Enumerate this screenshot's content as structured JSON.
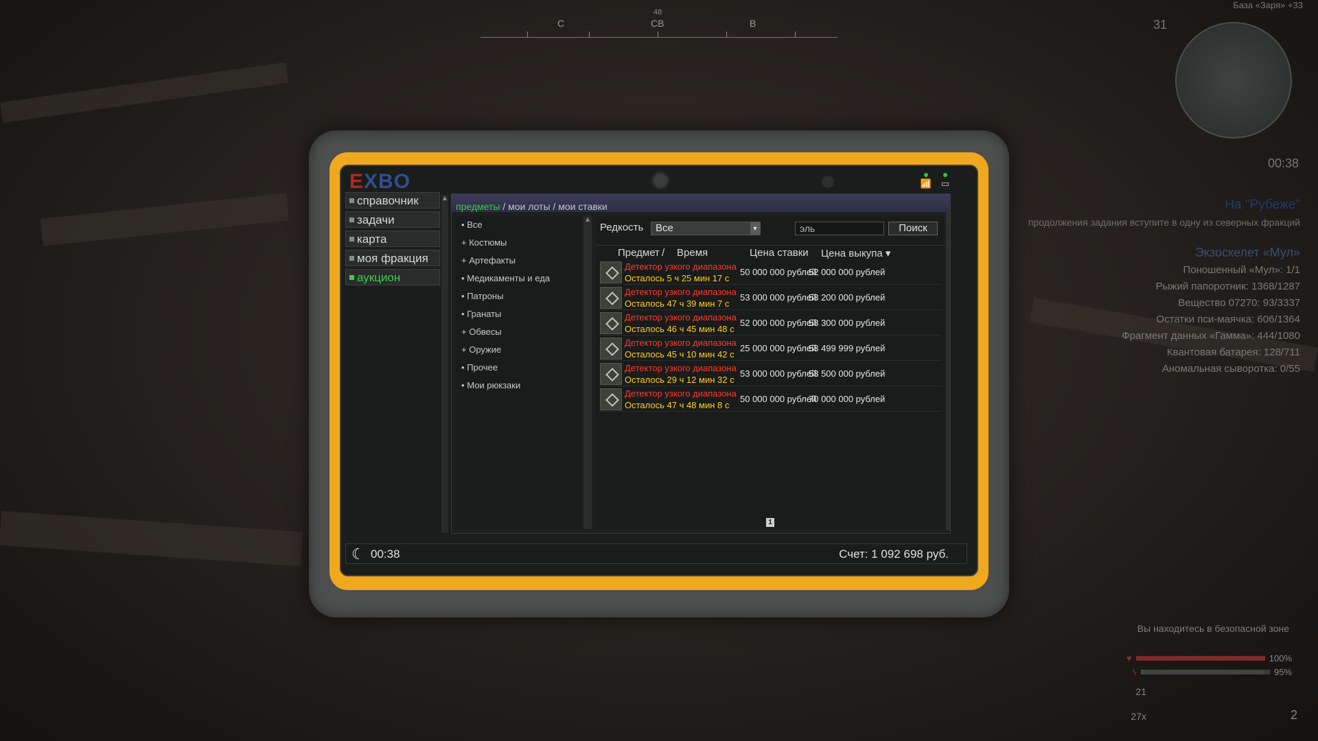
{
  "hud": {
    "compass": {
      "heading": "48",
      "labels": [
        "С",
        "СВ",
        "В"
      ]
    },
    "top_text": "База «Заря» +33",
    "level": "31",
    "time": "00:38",
    "quest": {
      "title": "На \"Рубеже\"",
      "description": "продолжения задания вступите в одну из северных фракций",
      "subtitle": "Экзоскелет «Мул»",
      "items": [
        "Поношенный «Мул»: 1/1",
        "Рыжий папоротник: 1368/1287",
        "Вещество 07270: 93/3337",
        "Остатки пси-маячка: 606/1364",
        "Фрагмент данных «Гамма»: 444/1080",
        "Квантовая батарея: 128/711",
        "Аномальная сыворотка: 0/55"
      ]
    },
    "safe_zone": "Вы находитесь в безопасной зоне",
    "health_percent": "100%",
    "stamina_percent": "95%",
    "health_level": 1.0,
    "stamina_level": 0.95,
    "ammo": "21",
    "ammo_reserve": "27x",
    "grenades": "2"
  },
  "tablet": {
    "logo_e": "E",
    "logo_rest": "XBO",
    "sidebar": [
      {
        "label": "справочник",
        "active": false
      },
      {
        "label": "задачи",
        "active": false
      },
      {
        "label": "карта",
        "active": false
      },
      {
        "label": "моя фракция",
        "active": false
      },
      {
        "label": "аукцион",
        "active": true
      }
    ],
    "breadcrumbs": {
      "current": "предметы",
      "sep": "/",
      "lots": "мои лоты",
      "bids": "мои ставки"
    },
    "categories": [
      {
        "prefix": "•",
        "label": "Все"
      },
      {
        "prefix": "+",
        "label": "Костюмы"
      },
      {
        "prefix": "+",
        "label": "Артефакты"
      },
      {
        "prefix": "•",
        "label": "Медикаменты и еда"
      },
      {
        "prefix": "•",
        "label": "Патроны"
      },
      {
        "prefix": "•",
        "label": "Гранаты"
      },
      {
        "prefix": "+",
        "label": "Обвесы"
      },
      {
        "prefix": "+",
        "label": "Оружие"
      },
      {
        "prefix": "•",
        "label": "Прочее"
      },
      {
        "prefix": "•",
        "label": "Мои рюкзаки"
      }
    ],
    "filter": {
      "label": "Редкость",
      "selected": "Все"
    },
    "search": {
      "value": "эль",
      "button": "Поиск"
    },
    "columns": {
      "item": "Предмет",
      "sep": "/",
      "time": "Время",
      "bid": "Цена ставки",
      "buyout": "Цена выкупа ▾"
    },
    "lots": [
      {
        "name": "Детектор узкого диапазона «Эл..",
        "time": "Осталось 5 ч 25 мин 17 с",
        "bid": "50 000 000 рублей",
        "buyout": "52 000 000 рублей"
      },
      {
        "name": "Детектор узкого диапазона «Эл..",
        "time": "Осталось 47 ч 39 мин 7 с",
        "bid": "53 000 000 рублей",
        "buyout": "53 200 000 рублей"
      },
      {
        "name": "Детектор узкого диапазона «Эл..",
        "time": "Осталось 46 ч 45 мин 48 с",
        "bid": "52 000 000 рублей",
        "buyout": "53 300 000 рублей"
      },
      {
        "name": "Детектор узкого диапазона «Эл..",
        "time": "Осталось 45 ч 10 мин 42 с",
        "bid": "25 000 000 рублей",
        "buyout": "53 499 999 рублей"
      },
      {
        "name": "Детектор узкого диапазона «Эл..",
        "time": "Осталось 29 ч 12 мин 32 с",
        "bid": "53 000 000 рублей",
        "buyout": "53 500 000 рублей"
      },
      {
        "name": "Детектор узкого диапазона «Эл..",
        "time": "Осталось 47 ч 48 мин 8 с",
        "bid": "50 000 000 рублей",
        "buyout": "70 000 000 рублей"
      }
    ],
    "page": "1",
    "footer": {
      "time": "00:38",
      "account": "Счет: 1 092 698 руб."
    }
  }
}
